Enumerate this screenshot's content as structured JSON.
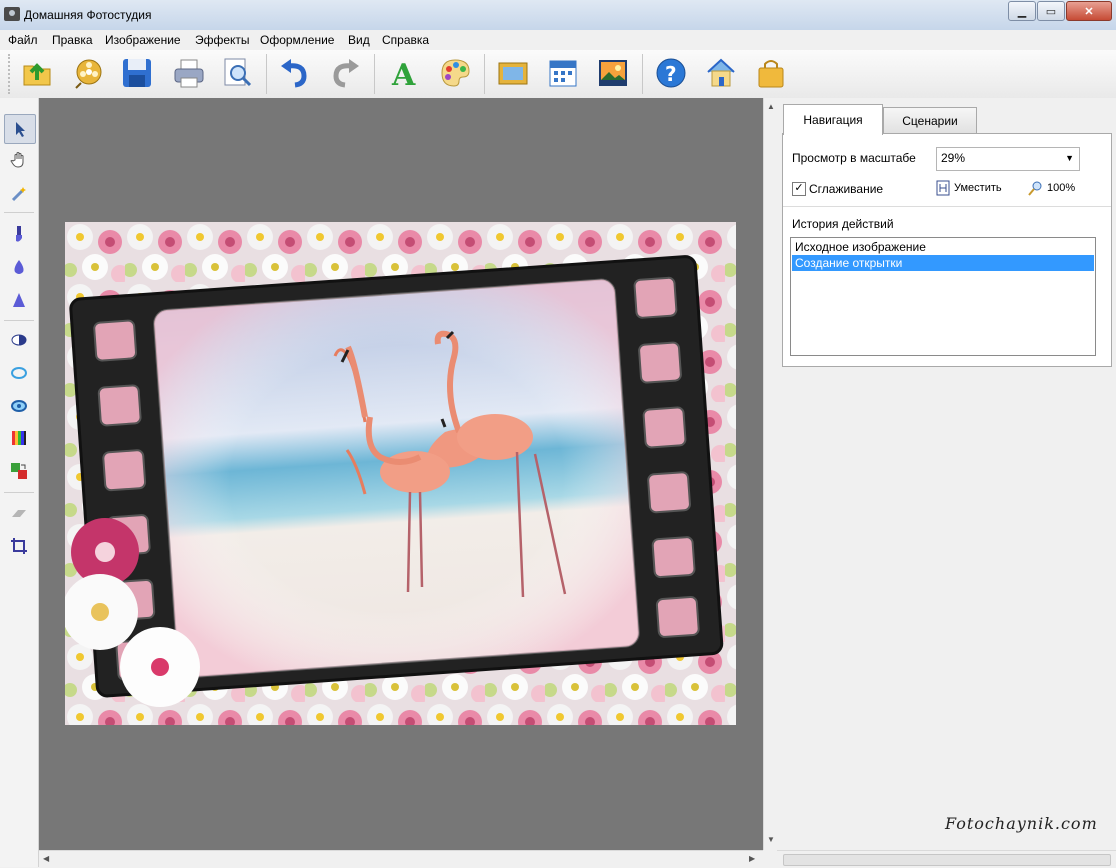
{
  "window": {
    "title": "Домашняя Фотостудия",
    "min_glyph": "▁",
    "max_glyph": "▭",
    "close_glyph": "✕"
  },
  "menu": [
    "Файл",
    "Правка",
    "Изображение",
    "Эффекты",
    "Оформление",
    "Вид",
    "Справка"
  ],
  "toolbar_icons": [
    "open-icon",
    "film-reel-icon",
    "save-icon",
    "print-icon",
    "preview-icon",
    "undo-icon",
    "redo-icon",
    "text-icon",
    "palette-icon",
    "frame-icon",
    "calendar-icon",
    "collage-icon",
    "help-icon",
    "home-icon",
    "bag-icon"
  ],
  "tools": [
    "pointer-tool-icon",
    "hand-tool-icon",
    "magic-wand-icon",
    "brush-icon",
    "drop-icon",
    "sharpen-icon",
    "contrast-icon",
    "ring-icon",
    "eye-icon",
    "color-balance-icon",
    "replace-color-icon",
    "eraser-icon",
    "crop-icon"
  ],
  "panel": {
    "tabs": [
      "Навигация",
      "Сценарии"
    ],
    "zoom_label": "Просмотр в масштабе",
    "zoom_value": "29%",
    "smoothing_label": "Сглаживание",
    "smoothing_checked": true,
    "fit_label": "Уместить",
    "hundred_label": "100%",
    "history_label": "История действий",
    "history": [
      "Исходное изображение",
      "Создание открытки"
    ],
    "history_selected": 1
  },
  "watermark": "Fotochaynik.com",
  "colors": {
    "canvas": "#777777",
    "selection": "#3399ff"
  }
}
